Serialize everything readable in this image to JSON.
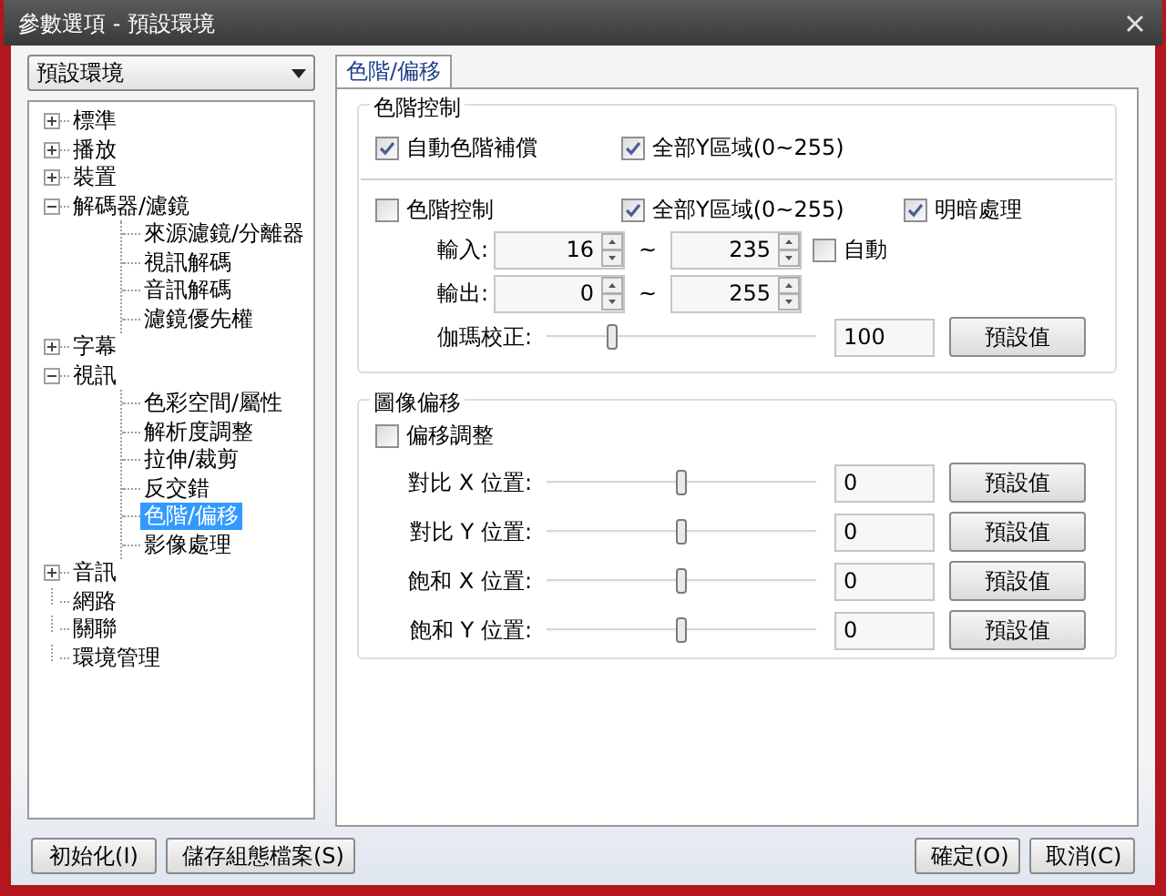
{
  "window": {
    "title": "參數選項 - 預設環境"
  },
  "profile_dropdown": {
    "value": "預設環境"
  },
  "tree": [
    {
      "label": "標準",
      "selected": false,
      "expanded": false
    },
    {
      "label": "播放",
      "selected": false,
      "expanded": false
    },
    {
      "label": "裝置",
      "selected": false,
      "expanded": false
    },
    {
      "label": "解碼器/濾鏡",
      "selected": false,
      "expanded": true,
      "children": [
        {
          "label": "來源濾鏡/分離器",
          "selected": false
        },
        {
          "label": "視訊解碼",
          "selected": false
        },
        {
          "label": "音訊解碼",
          "selected": false
        },
        {
          "label": "濾鏡優先權",
          "selected": false
        }
      ]
    },
    {
      "label": "字幕",
      "selected": false,
      "expanded": false
    },
    {
      "label": "視訊",
      "selected": false,
      "expanded": true,
      "children": [
        {
          "label": "色彩空間/屬性",
          "selected": false
        },
        {
          "label": "解析度調整",
          "selected": false
        },
        {
          "label": "拉伸/裁剪",
          "selected": false
        },
        {
          "label": "反交錯",
          "selected": false
        },
        {
          "label": "色階/偏移",
          "selected": true
        },
        {
          "label": "影像處理",
          "selected": false
        }
      ]
    },
    {
      "label": "音訊",
      "selected": false,
      "expanded": false
    },
    {
      "label": "網路",
      "selected": false
    },
    {
      "label": "關聯",
      "selected": false
    },
    {
      "label": "環境管理",
      "selected": false
    }
  ],
  "tab": {
    "label": "色階/偏移",
    "selected": true
  },
  "level_control": {
    "title": "色階控制",
    "auto_row": [
      {
        "label": "自動色階補償",
        "checked": true
      },
      {
        "label": "全部Y區域(0~255)",
        "checked": true
      }
    ],
    "manual_row": [
      {
        "label": "色階控制",
        "checked": false
      },
      {
        "label": "全部Y區域(0~255)",
        "checked": true
      },
      {
        "label": "明暗處理",
        "checked": true
      }
    ],
    "ranges": [
      {
        "label": "輸入:",
        "from": "16",
        "separator": "~",
        "to": "235",
        "auto": {
          "label": "自動",
          "checked": false
        }
      },
      {
        "label": "輸出:",
        "from": "0",
        "separator": "~",
        "to": "255"
      }
    ],
    "gamma": {
      "label": "伽瑪校正:",
      "level": 0.24,
      "value": "100",
      "button": "預設值"
    }
  },
  "image_offset": {
    "title": "圖像偏移",
    "enable": {
      "label": "偏移調整",
      "checked": false
    },
    "sliders": [
      {
        "label": "對比 X 位置:",
        "level": 0.5,
        "value": "0",
        "button": "預設值"
      },
      {
        "label": "對比 Y 位置:",
        "level": 0.5,
        "value": "0",
        "button": "預設值"
      },
      {
        "label": "飽和 X 位置:",
        "level": 0.5,
        "value": "0",
        "button": "預設值"
      },
      {
        "label": "飽和 Y 位置:",
        "level": 0.5,
        "value": "0",
        "button": "預設值"
      }
    ]
  },
  "buttons_left": [
    "初始化(I)",
    "儲存組態檔案(S)"
  ],
  "buttons_right": [
    "確定(O)",
    "取消(C)"
  ]
}
